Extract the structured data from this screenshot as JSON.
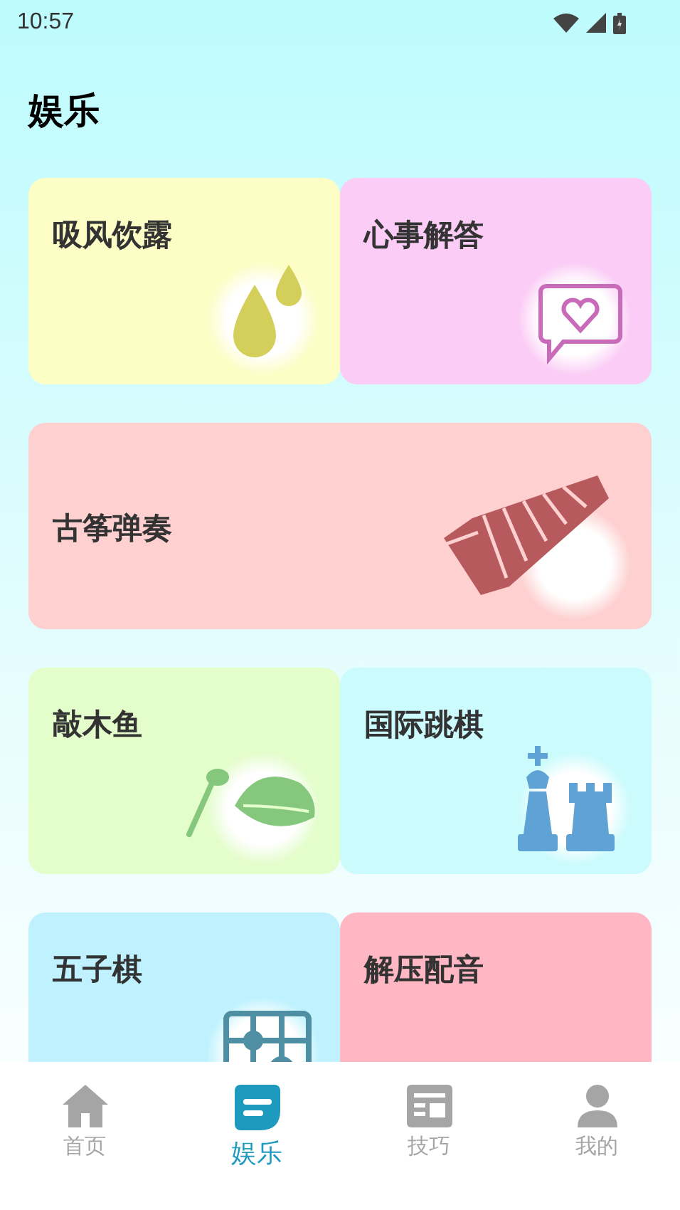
{
  "status_bar": {
    "time": "10:57"
  },
  "title": "娱乐",
  "cards": [
    {
      "title": "吸风饮露",
      "color": "#fdfdc6",
      "kind": "half"
    },
    {
      "title": "心事解答",
      "color": "#fbcdf6",
      "kind": "half"
    },
    {
      "title": "古筝弹奏",
      "color": "#fed0d0",
      "kind": "wide"
    },
    {
      "title": "敲木鱼",
      "color": "#e3fdcb",
      "kind": "half"
    },
    {
      "title": "国际跳棋",
      "color": "#cbfbfd",
      "kind": "half"
    },
    {
      "title": "五子棋",
      "color": "#bff2fe",
      "kind": "half"
    },
    {
      "title": "解压配音",
      "color": "#ffb7c4",
      "kind": "half"
    }
  ],
  "tabs": [
    {
      "label": "首页",
      "selected": false
    },
    {
      "label": "娱乐",
      "selected": true
    },
    {
      "label": "技巧",
      "selected": false
    },
    {
      "label": "我的",
      "selected": false
    }
  ]
}
